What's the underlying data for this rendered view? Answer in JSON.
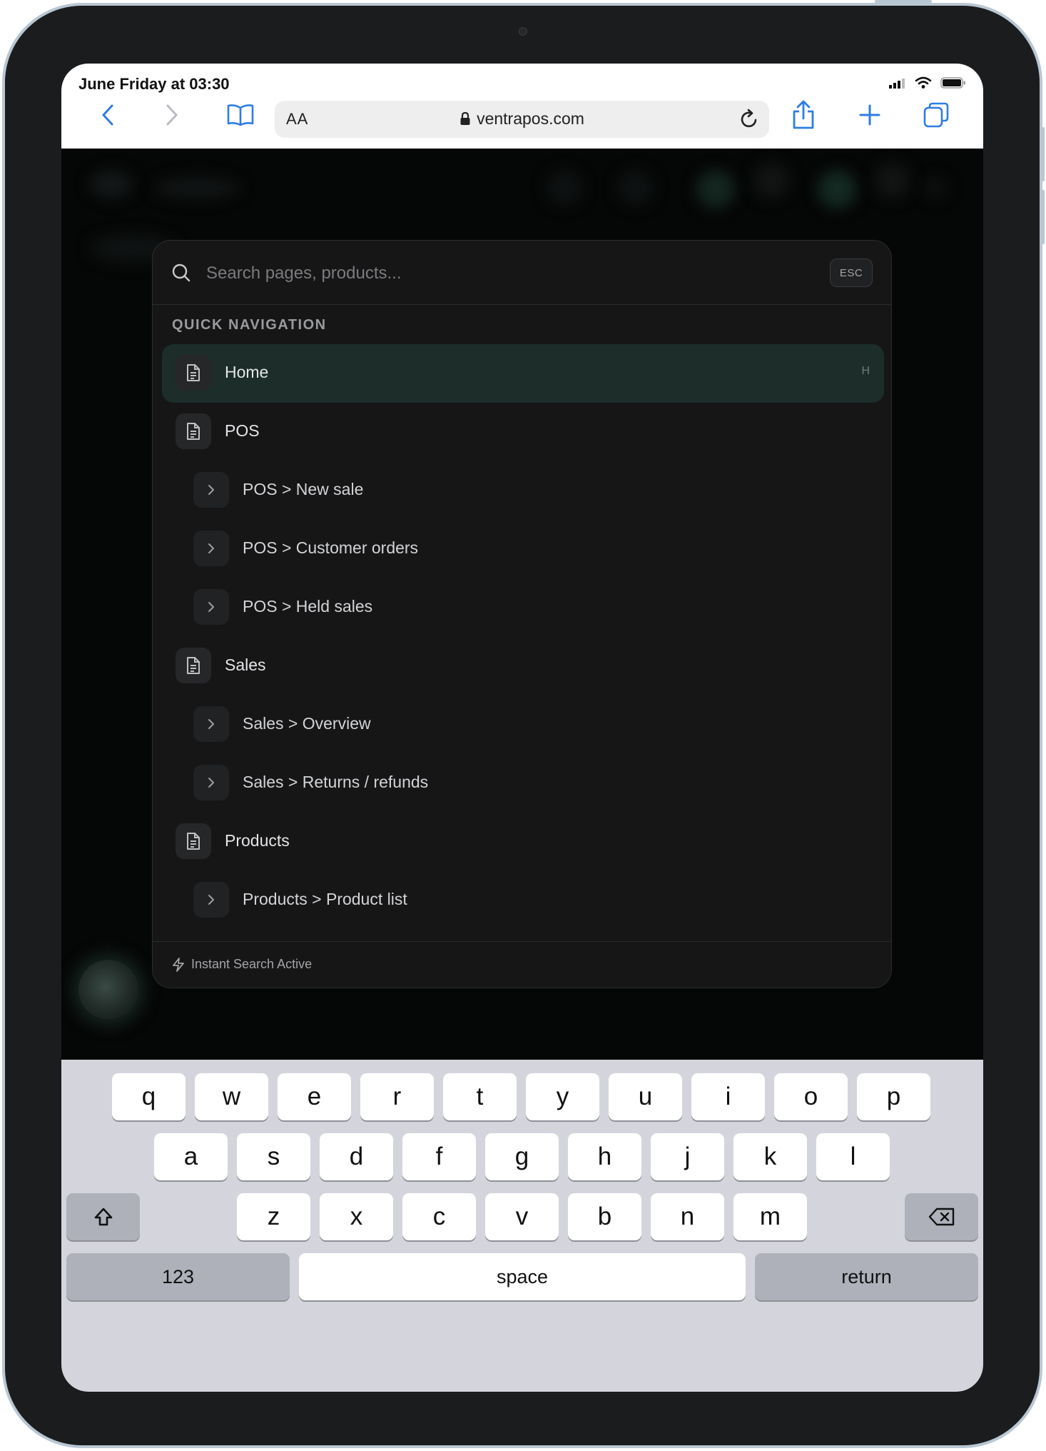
{
  "status_bar": {
    "time": "June Friday at 03:30"
  },
  "browser": {
    "aa_label": "AA",
    "url": "ventrapos.com",
    "toolbar_icons": [
      "back-chevron-icon",
      "forward-chevron-icon",
      "bookmarks-icon",
      "reload-icon",
      "share-icon",
      "new-tab-icon",
      "tabs-icon"
    ]
  },
  "palette": {
    "search_placeholder": "Search pages, products...",
    "esc_label": "ESC",
    "section_label": "QUICK NAVIGATION",
    "items": [
      {
        "label": "Home",
        "kind": "page",
        "shortcut": "H",
        "active": true
      },
      {
        "label": "POS",
        "kind": "page"
      },
      {
        "label": "POS > New sale",
        "kind": "sub"
      },
      {
        "label": "POS > Customer orders",
        "kind": "sub"
      },
      {
        "label": "POS > Held sales",
        "kind": "sub"
      },
      {
        "label": "Sales",
        "kind": "page"
      },
      {
        "label": "Sales > Overview",
        "kind": "sub"
      },
      {
        "label": "Sales > Returns / refunds",
        "kind": "sub"
      },
      {
        "label": "Products",
        "kind": "page"
      },
      {
        "label": "Products > Product list",
        "kind": "sub"
      }
    ],
    "footer_text": "Instant Search Active"
  },
  "keyboard": {
    "row1": [
      "q",
      "w",
      "e",
      "r",
      "t",
      "y",
      "u",
      "i",
      "o",
      "p"
    ],
    "row2": [
      "a",
      "s",
      "d",
      "f",
      "g",
      "h",
      "j",
      "k",
      "l"
    ],
    "row3": [
      "z",
      "x",
      "c",
      "v",
      "b",
      "n",
      "m"
    ],
    "numbers_label": "123",
    "space_label": "space",
    "return_label": "return"
  }
}
